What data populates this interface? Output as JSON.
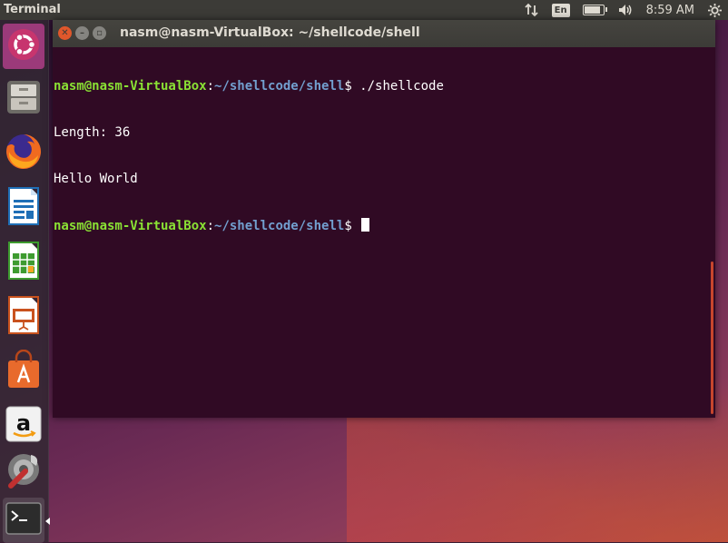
{
  "top_panel": {
    "app_name": "Terminal",
    "keyboard_layout": "En",
    "clock": "8:59 AM",
    "battery_level": 0.95
  },
  "launcher": {
    "items": [
      {
        "name": "ubuntu-dash",
        "icon": "ubuntu-logo-icon"
      },
      {
        "name": "files",
        "icon": "file-cabinet-icon"
      },
      {
        "name": "firefox",
        "icon": "firefox-icon"
      },
      {
        "name": "libreoffice-writer",
        "icon": "writer-document-icon"
      },
      {
        "name": "libreoffice-calc",
        "icon": "calc-spreadsheet-icon"
      },
      {
        "name": "libreoffice-impress",
        "icon": "impress-presentation-icon"
      },
      {
        "name": "software-center",
        "icon": "shopping-bag-icon"
      },
      {
        "name": "amazon",
        "icon": "amazon-icon"
      },
      {
        "name": "system-settings",
        "icon": "settings-wrench-icon"
      },
      {
        "name": "terminal",
        "icon": "terminal-icon",
        "active": true
      }
    ]
  },
  "window": {
    "title": "nasm@nasm-VirtualBox: ~/shellcode/shell"
  },
  "terminal": {
    "line1": {
      "user": "nasm@nasm-VirtualBox",
      "sep": ":",
      "path": "~/shellcode/shell",
      "dollar": "$ ",
      "command": "./shellcode"
    },
    "line2": "Length: 36",
    "line3": "Hello World",
    "line4": {
      "user": "nasm@nasm-VirtualBox",
      "sep": ":",
      "path": "~/shellcode/shell",
      "dollar": "$ "
    }
  },
  "colors": {
    "terminal_bg": "#300a24",
    "prompt_user": "#8ae234",
    "prompt_path": "#729fcf",
    "close_button": "#e0572b",
    "panel_bg": "#3c3b37"
  }
}
